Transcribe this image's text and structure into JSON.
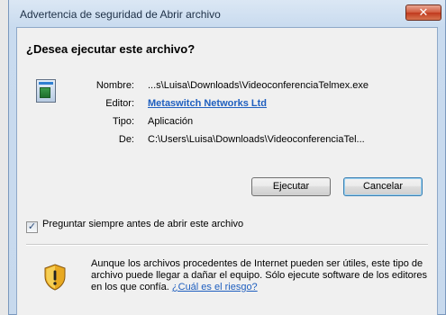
{
  "window": {
    "title": "Advertencia de seguridad de Abrir archivo",
    "close_glyph": "✕"
  },
  "dialog": {
    "heading": "¿Desea ejecutar este archivo?",
    "file_icon": "application-icon",
    "fields": {
      "name_label": "Nombre:",
      "name_value": "...s\\Luisa\\Downloads\\VideoconferenciaTelmex.exe",
      "publisher_label": "Editor:",
      "publisher_value": "Metaswitch Networks Ltd",
      "type_label": "Tipo:",
      "type_value": "Aplicación",
      "from_label": "De:",
      "from_value": "C:\\Users\\Luisa\\Downloads\\VideoconferenciaTel..."
    },
    "buttons": {
      "run": "Ejecutar",
      "cancel": "Cancelar"
    },
    "checkbox": {
      "checked": true,
      "label": "Preguntar siempre antes de abrir este archivo"
    },
    "warning": {
      "icon": "shield-warning-icon",
      "text": "Aunque los archivos procedentes de Internet pueden ser útiles, este tipo de archivo puede llegar a dañar el equipo. Sólo ejecute software de los editores en los que confía.",
      "link": "¿Cuál es el riesgo?"
    }
  },
  "colors": {
    "link": "#1f5fbf",
    "close_button": "#c0391d",
    "frame": "#c9dbef"
  }
}
